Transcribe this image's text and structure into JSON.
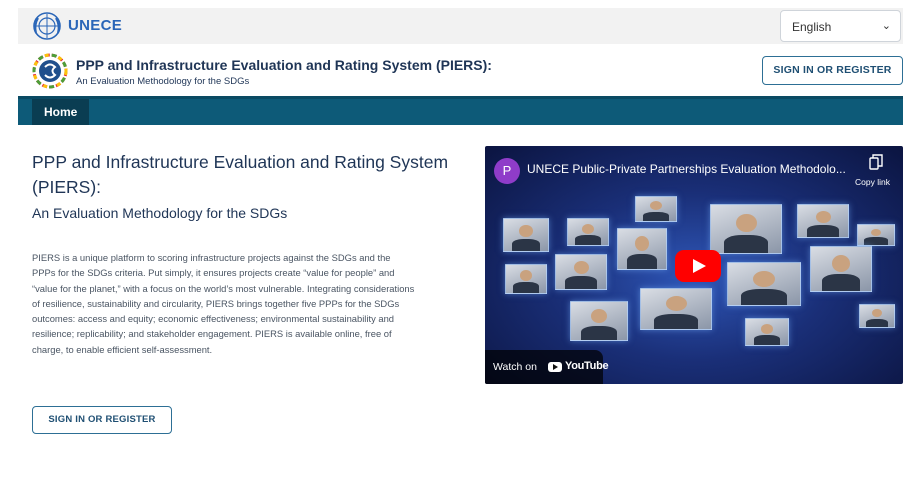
{
  "topbar": {
    "brand": "UNECE",
    "language": {
      "selected": "English"
    }
  },
  "header": {
    "title": "PPP and Infrastructure Evaluation and Rating System (PIERS):",
    "subtitle": "An Evaluation Methodology for the SDGs",
    "signin_label": "SIGN IN OR REGISTER"
  },
  "nav": {
    "home_label": "Home"
  },
  "hero": {
    "title": "PPP and Infrastructure Evaluation and Rating System (PIERS):",
    "subtitle": "An Evaluation Methodology for the SDGs",
    "body": "PIERS is a unique platform to scoring infrastructure projects against the SDGs and the PPPs for the SDGs criteria. Put simply, it ensures projects create “value for people” and “value for the planet,” with a focus on the world’s most vulnerable. Integrating considerations of resilience, sustainability and circularity, PIERS brings together five PPPs for the SDGs outcomes: access and equity; economic effectiveness; environmental sustainability and resilience; replicability; and stakeholder engagement. PIERS is available online, free of charge, to enable efficient self-assessment.",
    "signin_label": "SIGN IN OR REGISTER"
  },
  "video": {
    "channel_initial": "P",
    "title": "UNECE Public-Private Partnerships Evaluation Methodolo...",
    "copy_label": "Copy link",
    "watch_label": "Watch on",
    "youtube_label": "YouTube",
    "play_color": "#ff0000"
  },
  "colors": {
    "nav_bg": "#0d5a78",
    "brand_blue": "#2b66b8",
    "title_text": "#1f3556"
  }
}
